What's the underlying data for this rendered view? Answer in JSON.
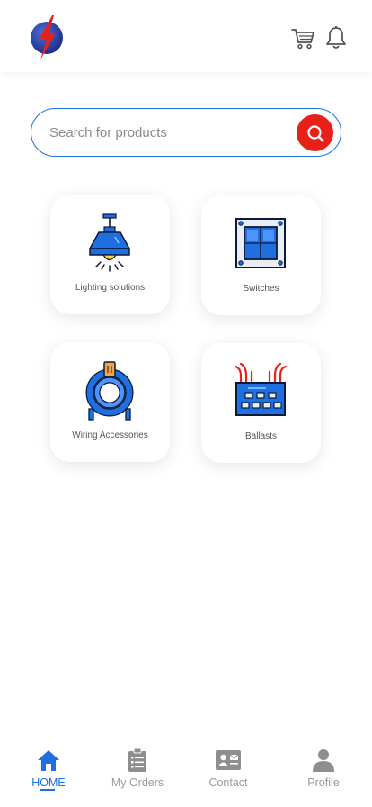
{
  "header": {
    "logo_icon": "lightning-logo-icon",
    "cart_icon": "cart-icon",
    "bell_icon": "bell-icon"
  },
  "search": {
    "placeholder": "Search for products",
    "value": "",
    "button_icon": "search-icon"
  },
  "categories": [
    {
      "label": "Lighting solutions",
      "icon": "pendant-lamp-icon"
    },
    {
      "label": "Switches",
      "icon": "switch-panel-icon"
    },
    {
      "label": "Wiring Accessories",
      "icon": "cable-coil-icon"
    },
    {
      "label": "Ballasts",
      "icon": "ballast-icon"
    }
  ],
  "nav": {
    "items": [
      {
        "label": "HOME",
        "icon": "home-icon",
        "active": true
      },
      {
        "label": "My Orders",
        "icon": "clipboard-icon",
        "active": false
      },
      {
        "label": "Contact",
        "icon": "contact-card-icon",
        "active": false
      },
      {
        "label": "Profile",
        "icon": "user-icon",
        "active": false
      }
    ]
  },
  "colors": {
    "accent": "#1f6fe0",
    "search_button": "#e8201a",
    "muted": "#9a9a9a"
  }
}
